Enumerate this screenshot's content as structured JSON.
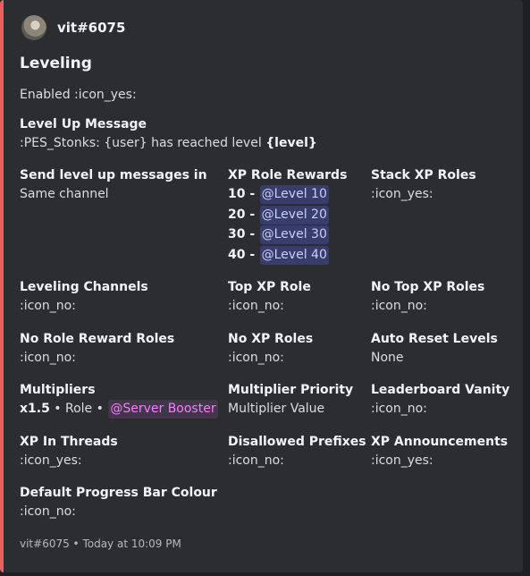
{
  "author": {
    "name": "vit#6075"
  },
  "title": "Leveling",
  "description": "Enabled :icon_yes:",
  "level_up_message": {
    "name": "Level Up Message",
    "prefix": ":PES_Stonks: {user} has reached level ",
    "bold": "{level}"
  },
  "fields": {
    "send_level_up": {
      "name": "Send level up messages in",
      "value": "Same channel"
    },
    "xp_role_rewards": {
      "name": "XP Role Rewards",
      "rewards": [
        {
          "level": "10 -",
          "role": "@Level 10"
        },
        {
          "level": "20 -",
          "role": "@Level 20"
        },
        {
          "level": "30 -",
          "role": "@Level 30"
        },
        {
          "level": "40 -",
          "role": "@Level 40"
        }
      ]
    },
    "stack_xp_roles": {
      "name": "Stack XP Roles",
      "value": ":icon_yes:"
    },
    "leveling_channels": {
      "name": "Leveling Channels",
      "value": ":icon_no:"
    },
    "top_xp_role": {
      "name": "Top XP Role",
      "value": ":icon_no:"
    },
    "no_top_xp_roles": {
      "name": "No Top XP Roles",
      "value": ":icon_no:"
    },
    "no_role_reward_roles": {
      "name": "No Role Reward Roles",
      "value": ":icon_no:"
    },
    "no_xp_roles": {
      "name": "No XP Roles",
      "value": ":icon_no:"
    },
    "auto_reset_levels": {
      "name": "Auto Reset Levels",
      "value": "None"
    },
    "multipliers": {
      "name": "Multipliers",
      "multiplier": "x1.5",
      "separator": " • Role • ",
      "role": "@Server Booster"
    },
    "multiplier_priority": {
      "name": "Multiplier Priority",
      "value": "Multiplier Value"
    },
    "leaderboard_vanity": {
      "name": "Leaderboard Vanity",
      "value": ":icon_no:"
    },
    "xp_in_threads": {
      "name": "XP In Threads",
      "value": ":icon_yes:"
    },
    "disallowed_prefixes": {
      "name": "Disallowed Prefixes",
      "value": ":icon_no:"
    },
    "xp_announcements": {
      "name": "XP Announcements",
      "value": ":icon_yes:"
    },
    "default_progress_bar_colour": {
      "name": "Default Progress Bar Colour",
      "value": ":icon_no:"
    }
  },
  "footer": {
    "text": "vit#6075 • Today at 10:09 PM"
  },
  "colors": {
    "embed_border": "#ee5c63",
    "background": "#2b2d31",
    "role_mention": "#c9cdfb",
    "booster_mention": "#f47fff"
  }
}
